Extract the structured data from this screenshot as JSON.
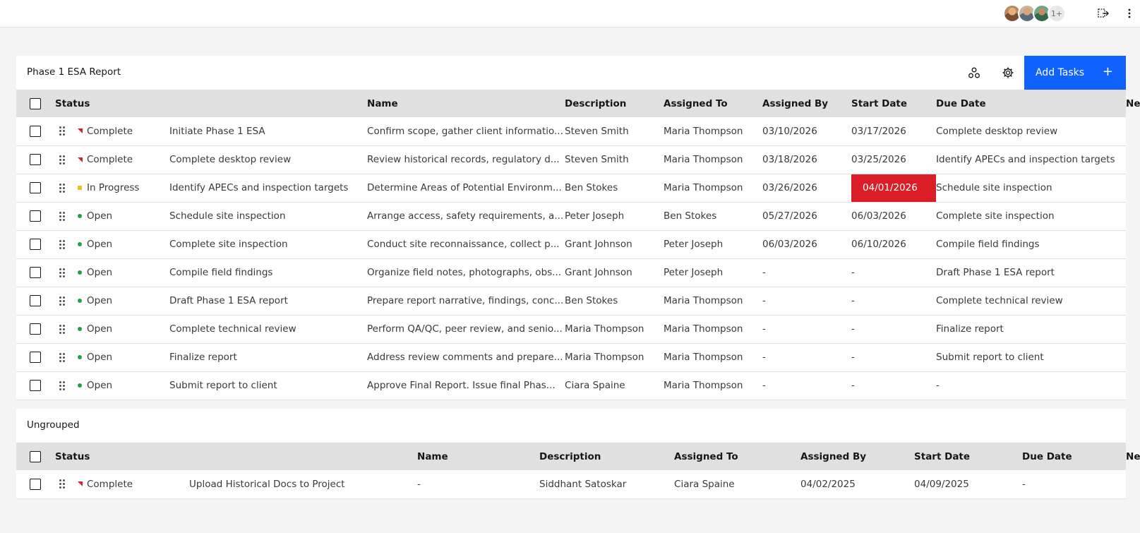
{
  "topbar": {
    "avatars": [
      "user-avatar-1",
      "user-avatar-2",
      "user-avatar-3"
    ],
    "more_count": "1+"
  },
  "group1": {
    "title": "Phase 1 ESA Report",
    "add_button": "Add Tasks",
    "add_icon": "+",
    "columns": [
      "Status",
      "Name",
      "Description",
      "Assigned To",
      "Assigned By",
      "Start Date",
      "Due Date",
      "Next Task"
    ],
    "rows": [
      {
        "status": "Complete",
        "status_kind": "complete",
        "name": "Initiate Phase 1 ESA",
        "description": "Confirm scope, gather client informatio...",
        "assigned_to": "Steven Smith",
        "assigned_by": "Maria Thompson",
        "start": "03/10/2026",
        "due": "03/17/2026",
        "next": "Complete desktop review"
      },
      {
        "status": "Complete",
        "status_kind": "complete",
        "name": "Complete desktop review",
        "description": "Review historical records, regulatory d...",
        "assigned_to": "Steven Smith",
        "assigned_by": "Maria Thompson",
        "start": "03/18/2026",
        "due": "03/25/2026",
        "next": "Identify APECs and inspection targets"
      },
      {
        "status": "In Progress",
        "status_kind": "progress",
        "name": "Identify APECs and inspection targets",
        "description": "Determine Areas of Potential Environm...",
        "assigned_to": "Ben Stokes",
        "assigned_by": "Maria Thompson",
        "start": "03/26/2026",
        "due": "04/01/2026",
        "due_overdue": true,
        "next": "Schedule site inspection"
      },
      {
        "status": "Open",
        "status_kind": "open",
        "name": "Schedule site inspection",
        "description": "Arrange access, safety requirements, a...",
        "assigned_to": "Peter Joseph",
        "assigned_by": "Ben Stokes",
        "start": "05/27/2026",
        "due": "06/03/2026",
        "next": "Complete site inspection"
      },
      {
        "status": "Open",
        "status_kind": "open",
        "name": "Complete site inspection",
        "description": "Conduct site reconnaissance, collect p...",
        "assigned_to": "Grant Johnson",
        "assigned_by": "Peter Joseph",
        "start": "06/03/2026",
        "due": "06/10/2026",
        "next": "Compile field findings"
      },
      {
        "status": "Open",
        "status_kind": "open",
        "name": "Compile field findings",
        "description": "Organize field notes, photographs, obs...",
        "assigned_to": "Grant Johnson",
        "assigned_by": "Peter Joseph",
        "start": "-",
        "due": "-",
        "next": "Draft Phase 1 ESA report"
      },
      {
        "status": "Open",
        "status_kind": "open",
        "name": "Draft Phase 1 ESA report",
        "description": "Prepare report narrative, findings, conc...",
        "assigned_to": "Ben Stokes",
        "assigned_by": "Maria Thompson",
        "start": "-",
        "due": "-",
        "next": "Complete technical review"
      },
      {
        "status": "Open",
        "status_kind": "open",
        "name": "Complete technical review",
        "description": "Perform QA/QC, peer review, and senio...",
        "assigned_to": "Maria Thompson",
        "assigned_by": "Maria Thompson",
        "start": "-",
        "due": "-",
        "next": "Finalize report"
      },
      {
        "status": "Open",
        "status_kind": "open",
        "name": "Finalize report",
        "description": "Address review comments and prepare...",
        "assigned_to": "Maria Thompson",
        "assigned_by": "Maria Thompson",
        "start": "-",
        "due": "-",
        "next": "Submit report to client"
      },
      {
        "status": "Open",
        "status_kind": "open",
        "name": "Submit report to client",
        "description": "Approve Final Report. Issue final Phas...",
        "assigned_to": "Ciara Spaine",
        "assigned_by": "Maria Thompson",
        "start": "-",
        "due": "-",
        "next": "-"
      }
    ]
  },
  "group2": {
    "title": "Ungrouped",
    "columns": [
      "Status",
      "Name",
      "Description",
      "Assigned To",
      "Assigned By",
      "Start Date",
      "Due Date",
      "Next Task"
    ],
    "rows": [
      {
        "status": "Complete",
        "status_kind": "complete",
        "name": "Upload Historical Docs to Project",
        "description": "-",
        "assigned_to": "Siddhant Satoskar",
        "assigned_by": "Ciara Spaine",
        "start": "04/02/2025",
        "due": "04/09/2025",
        "next": "-"
      }
    ]
  },
  "colors": {
    "primary": "#0f62fe",
    "overdue": "#da1e28",
    "open": "#24a148",
    "progress": "#f1c21b",
    "complete": "#da1e28"
  }
}
